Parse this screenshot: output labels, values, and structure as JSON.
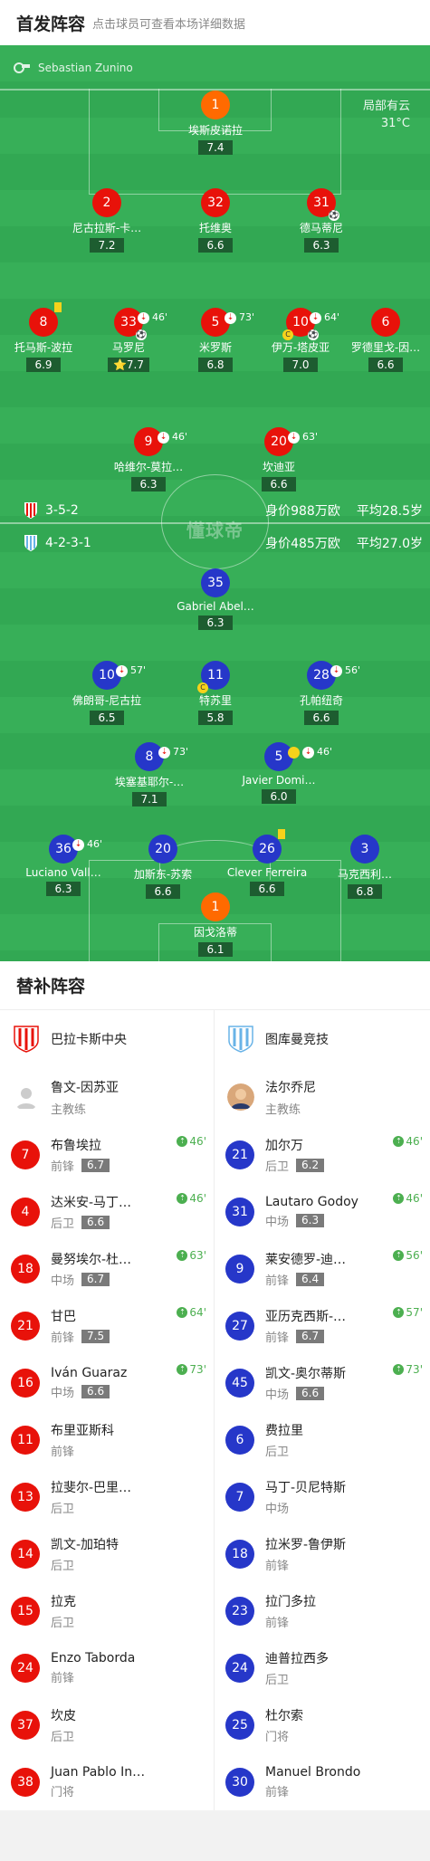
{
  "header": {
    "title": "首发阵容",
    "subtitle": "点击球员可查看本场详细数据"
  },
  "referee": "Sebastian Zunino",
  "weather": {
    "condition": "局部有云",
    "temp": "31°C"
  },
  "home_form": {
    "formation": "3-5-2",
    "value": "身价988万欧",
    "age": "平均28.5岁"
  },
  "away_form": {
    "formation": "4-2-3-1",
    "value": "身价485万欧",
    "age": "平均27.0岁"
  },
  "watermark": "懂球帝",
  "home_players": [
    {
      "num": "1",
      "name": "埃斯皮诺拉",
      "rating": "7.4"
    },
    {
      "num": "2",
      "name": "尼古拉斯-卡…",
      "rating": "7.2"
    },
    {
      "num": "32",
      "name": "托维奥",
      "rating": "6.6"
    },
    {
      "num": "31",
      "name": "德马蒂尼",
      "rating": "6.3"
    },
    {
      "num": "8",
      "name": "托马斯-波拉",
      "rating": "6.9"
    },
    {
      "num": "33",
      "name": "马罗尼",
      "rating": "7.7",
      "sub": "46'"
    },
    {
      "num": "5",
      "name": "米罗斯",
      "rating": "6.8",
      "sub": "73'"
    },
    {
      "num": "10",
      "name": "伊万-塔皮亚",
      "rating": "7.0",
      "sub": "64'"
    },
    {
      "num": "6",
      "name": "罗德里戈-因…",
      "rating": "6.6"
    },
    {
      "num": "9",
      "name": "哈维尔-莫拉…",
      "rating": "6.3",
      "sub": "46'"
    },
    {
      "num": "20",
      "name": "坎迪亚",
      "rating": "6.6",
      "sub": "63'"
    }
  ],
  "away_players": [
    {
      "num": "35",
      "name": "Gabriel Abel…",
      "rating": "6.3"
    },
    {
      "num": "10",
      "name": "佛朗哥-尼古拉",
      "rating": "6.5",
      "sub": "57'"
    },
    {
      "num": "11",
      "name": "特苏里",
      "rating": "5.8"
    },
    {
      "num": "28",
      "name": "孔帕纽奇",
      "rating": "6.6",
      "sub": "56'"
    },
    {
      "num": "8",
      "name": "埃塞基耶尔-…",
      "rating": "7.1",
      "sub": "73'"
    },
    {
      "num": "5",
      "name": "Javier Domi…",
      "rating": "6.0",
      "sub": "46'"
    },
    {
      "num": "36",
      "name": "Luciano Vall…",
      "rating": "6.3",
      "sub": "46'"
    },
    {
      "num": "20",
      "name": "加斯东-苏索",
      "rating": "6.6"
    },
    {
      "num": "26",
      "name": "Clever Ferreira",
      "rating": "6.6"
    },
    {
      "num": "3",
      "name": "马克西利…",
      "rating": "6.8"
    },
    {
      "num": "1",
      "name": "因戈洛蒂",
      "rating": "6.1"
    }
  ],
  "bench": {
    "title": "替补阵容",
    "home": {
      "team": "巴拉卡斯中央",
      "coach": {
        "name": "鲁文-因苏亚",
        "role": "主教练"
      },
      "players": [
        {
          "num": "7",
          "name": "布鲁埃拉",
          "pos": "前锋",
          "rating": "6.7",
          "evt": "46'"
        },
        {
          "num": "4",
          "name": "达米安-马丁…",
          "pos": "后卫",
          "rating": "6.6",
          "evt": "46'"
        },
        {
          "num": "18",
          "name": "曼努埃尔-杜…",
          "pos": "中场",
          "rating": "6.7",
          "evt": "63'"
        },
        {
          "num": "21",
          "name": "甘巴",
          "pos": "前锋",
          "rating": "7.5",
          "evt": "64'"
        },
        {
          "num": "16",
          "name": "Iván Guaraz",
          "pos": "中场",
          "rating": "6.6",
          "evt": "73'"
        },
        {
          "num": "11",
          "name": "布里亚斯科",
          "pos": "前锋"
        },
        {
          "num": "13",
          "name": "拉斐尔-巴里…",
          "pos": "后卫"
        },
        {
          "num": "14",
          "name": "凯文-加珀特",
          "pos": "后卫"
        },
        {
          "num": "15",
          "name": "拉克",
          "pos": "后卫"
        },
        {
          "num": "24",
          "name": "Enzo Taborda",
          "pos": "前锋"
        },
        {
          "num": "37",
          "name": "坎皮",
          "pos": "后卫"
        },
        {
          "num": "38",
          "name": "Juan Pablo In…",
          "pos": "门将"
        }
      ]
    },
    "away": {
      "team": "图库曼竞技",
      "coach": {
        "name": "法尔乔尼",
        "role": "主教练"
      },
      "players": [
        {
          "num": "21",
          "name": "加尔万",
          "pos": "后卫",
          "rating": "6.2",
          "evt": "46'"
        },
        {
          "num": "31",
          "name": "Lautaro Godoy",
          "pos": "中场",
          "rating": "6.3",
          "evt": "46'"
        },
        {
          "num": "9",
          "name": "莱安德罗-迪…",
          "pos": "前锋",
          "rating": "6.4",
          "evt": "56'"
        },
        {
          "num": "27",
          "name": "亚历克西斯-…",
          "pos": "前锋",
          "rating": "6.7",
          "evt": "57'"
        },
        {
          "num": "45",
          "name": "凯文-奥尔蒂斯",
          "pos": "中场",
          "rating": "6.6",
          "evt": "73'"
        },
        {
          "num": "6",
          "name": "费拉里",
          "pos": "后卫"
        },
        {
          "num": "7",
          "name": "马丁-贝尼特斯",
          "pos": "中场"
        },
        {
          "num": "18",
          "name": "拉米罗-鲁伊斯",
          "pos": "前锋"
        },
        {
          "num": "23",
          "name": "拉门多拉",
          "pos": "前锋"
        },
        {
          "num": "24",
          "name": "迪普拉西多",
          "pos": "后卫"
        },
        {
          "num": "25",
          "name": "杜尔索",
          "pos": "门将"
        },
        {
          "num": "30",
          "name": "Manuel Brondo",
          "pos": "前锋"
        }
      ]
    }
  },
  "colors": {
    "pitch": "#32a853",
    "home": "#e8120a",
    "away": "#2637c9",
    "gk": "#ff6a00"
  }
}
